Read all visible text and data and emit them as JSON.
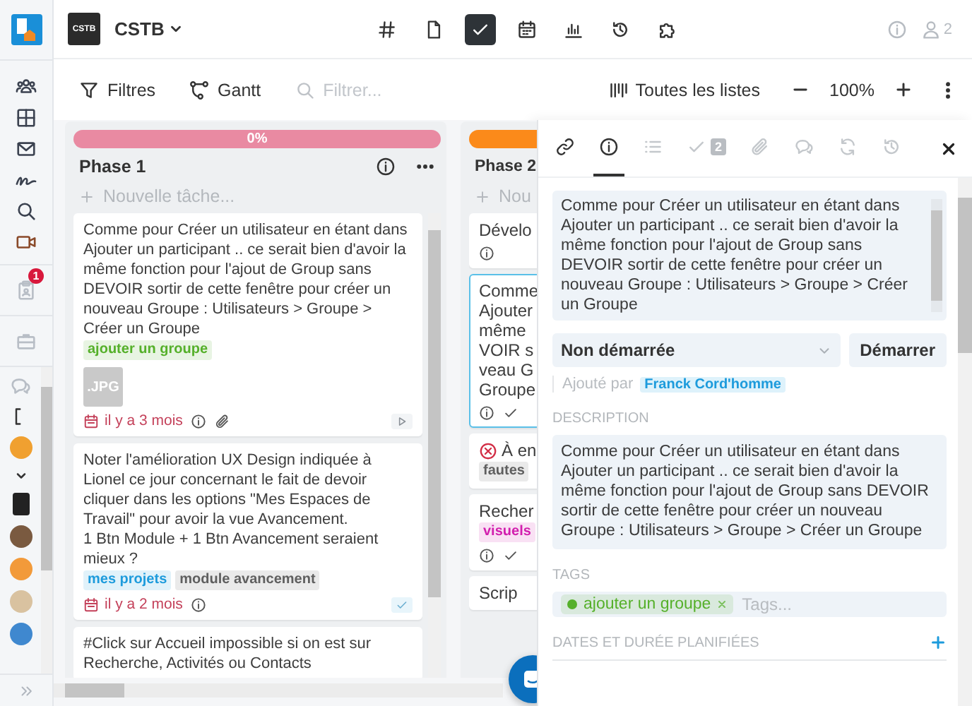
{
  "sidebar": {
    "notification_count": "1"
  },
  "header": {
    "logo_text": "CSTB",
    "workspace": "CSTB",
    "views": [
      {
        "kind": "hash",
        "selected": false
      },
      {
        "kind": "document",
        "selected": false
      },
      {
        "kind": "tasks",
        "selected": true
      },
      {
        "kind": "calendar",
        "selected": false
      },
      {
        "kind": "chart",
        "selected": false
      },
      {
        "kind": "history",
        "selected": false
      },
      {
        "kind": "puzzle",
        "selected": false
      }
    ],
    "members": "2"
  },
  "toolbar": {
    "filters": "Filtres",
    "gantt": "Gantt",
    "search": {
      "placeholder": "Filtrer..."
    },
    "lists": "Toutes les listes",
    "zoom": "100%"
  },
  "board": {
    "columns": [
      {
        "title": "Phase 1",
        "color": "#e98aa2",
        "progress": "0%",
        "new_task": "Nouvelle tâche...",
        "cards": [
          {
            "text": "Comme pour Créer un utilisateur en étant dans Ajouter un participant .. ce serait bien d'avoir la même fonction pour l'ajout de Group sans DEVOIR sortir de cette fenêtre pour créer un nouveau Groupe :  Utilisateurs > Groupe > Créer un Groupe",
            "tags": [
              {
                "label": "ajouter un groupe",
                "color": "#55b02a"
              }
            ],
            "attachment": ".JPG",
            "date": "il y a 3 mois",
            "icons": [
              {
                "kind": "info"
              },
              {
                "kind": "clip"
              }
            ],
            "end": {
              "kind": "play"
            },
            "error": false,
            "selected": false
          },
          {
            "text": "Noter l'amélioration UX Design indiquée à Lionel ce jour concernant le fait de devoir cliquer dans les options \"Mes Espaces de Travail\" pour avoir la vue Avancement.\n1 Btn Module + 1 Btn Avancement seraient mieux ?",
            "tags": [
              {
                "label": "mes projets",
                "color": "#1d9bdc"
              },
              {
                "label": "module avancement",
                "color": "#5f5f5f"
              }
            ],
            "date": "il y a 2 mois",
            "icons": [
              {
                "kind": "info"
              }
            ],
            "end": {
              "kind": "check"
            },
            "error": false,
            "selected": false
          },
          {
            "text": "#Click sur Accueil impossible si on est sur Recherche, Activités ou Contacts",
            "error": false,
            "selected": false
          }
        ]
      },
      {
        "title": "Phase 2",
        "color": "#fb8a1a",
        "new_task": "Nou",
        "cards": [
          {
            "lines": [
              "Dévelo"
            ],
            "icons": [
              {
                "kind": "info"
              }
            ],
            "error": false,
            "selected": false
          },
          {
            "lines": [
              "Comme",
              "Ajouter",
              "même",
              "VOIR s",
              "veau G",
              "Groupe"
            ],
            "icons": [
              {
                "kind": "info"
              },
              {
                "kind": "check"
              }
            ],
            "error": false,
            "selected": true
          },
          {
            "lines": [
              "À en"
            ],
            "tags": [
              {
                "label": "fautes",
                "color": "#5f5f5f"
              }
            ],
            "error": true,
            "selected": false
          },
          {
            "lines": [
              "Recher"
            ],
            "tags": [
              {
                "label": "visuels",
                "color": "#d21fae"
              }
            ],
            "icons": [
              {
                "kind": "info"
              },
              {
                "kind": "check"
              }
            ],
            "error": false,
            "selected": false
          },
          {
            "lines": [
              "Scrip"
            ],
            "error": false,
            "selected": false
          }
        ]
      }
    ]
  },
  "panel": {
    "tabs": [
      {
        "kind": "link",
        "selected": false
      },
      {
        "kind": "info",
        "selected": true
      },
      {
        "kind": "list",
        "selected": false
      },
      {
        "kind": "check",
        "count": "2",
        "selected": false
      },
      {
        "kind": "clip",
        "selected": false
      },
      {
        "kind": "chat",
        "selected": false
      },
      {
        "kind": "refresh",
        "selected": false
      },
      {
        "kind": "history",
        "selected": false
      }
    ],
    "title": "Comme pour Créer un utilisateur en étant dans Ajouter un participant .. ce serait bien d'avoir la même fonction pour l'ajout de Group sans DEVOIR sortir de cette fenêtre pour créer un nouveau Groupe :  Utilisateurs > Groupe > Créer un Groupe",
    "status": "Non démarrée",
    "start_button": "Démarrer",
    "added_by_label": "Ajouté par",
    "added_by": "Franck Cord'homme",
    "description_label": "DESCRIPTION",
    "description": "Comme pour Créer un utilisateur en étant dans Ajouter un participant .. ce serait bien d'avoir la même fonction pour l'ajout de Group sans DEVOIR sortir de cette fenêtre pour créer un nouveau Groupe :  Utilisateurs > Groupe > Créer un Groupe",
    "tags_label": "TAGS",
    "tags": [
      {
        "label": "ajouter un groupe",
        "color": "#55b02a"
      }
    ],
    "tags_placeholder": "Tags...",
    "dates_label": "DATES ET DURÉE PLANIFIÉES"
  }
}
